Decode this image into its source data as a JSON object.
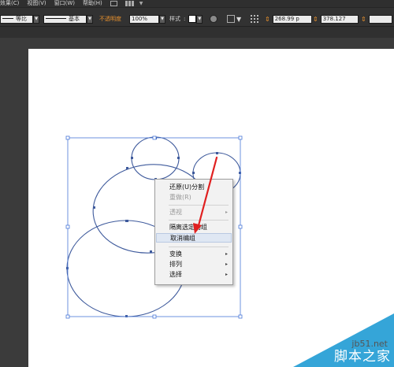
{
  "menubar": {
    "items": [
      {
        "label": "效果(C)"
      },
      {
        "label": "视图(V)"
      },
      {
        "label": "窗口(W)"
      },
      {
        "label": "帮助(H)"
      }
    ]
  },
  "controlbar": {
    "stroke_profile_label": "等比",
    "brush_label": "基本",
    "opacity_label": "不透明度",
    "opacity_value": "100%",
    "style_label": "样式",
    "x_value": "268.99 p",
    "w_value": "378.127",
    "colors": {
      "accent": "#e8912d"
    }
  },
  "context_menu": {
    "items": [
      {
        "label": "还原(U)分割",
        "enabled": true,
        "submenu": false
      },
      {
        "label": "重做(R)",
        "enabled": false,
        "submenu": false
      },
      {
        "label": "透视",
        "enabled": false,
        "submenu": true
      },
      {
        "label": "隔离选定的组",
        "enabled": true,
        "submenu": false
      },
      {
        "label": "取消编组",
        "enabled": true,
        "submenu": false,
        "highlighted": true
      },
      {
        "label": "变换",
        "enabled": true,
        "submenu": true
      },
      {
        "label": "排列",
        "enabled": true,
        "submenu": true
      },
      {
        "label": "选择",
        "enabled": true,
        "submenu": true
      }
    ],
    "submenu_arrow": "▸"
  },
  "canvas": {
    "shape_stroke_color": "#3e5a9c",
    "selection_color": "#4a78d8",
    "arrow_color": "#e02020"
  },
  "watermark": {
    "url": "jb51.net",
    "title": "脚本之家",
    "color": "#35a5d8"
  }
}
